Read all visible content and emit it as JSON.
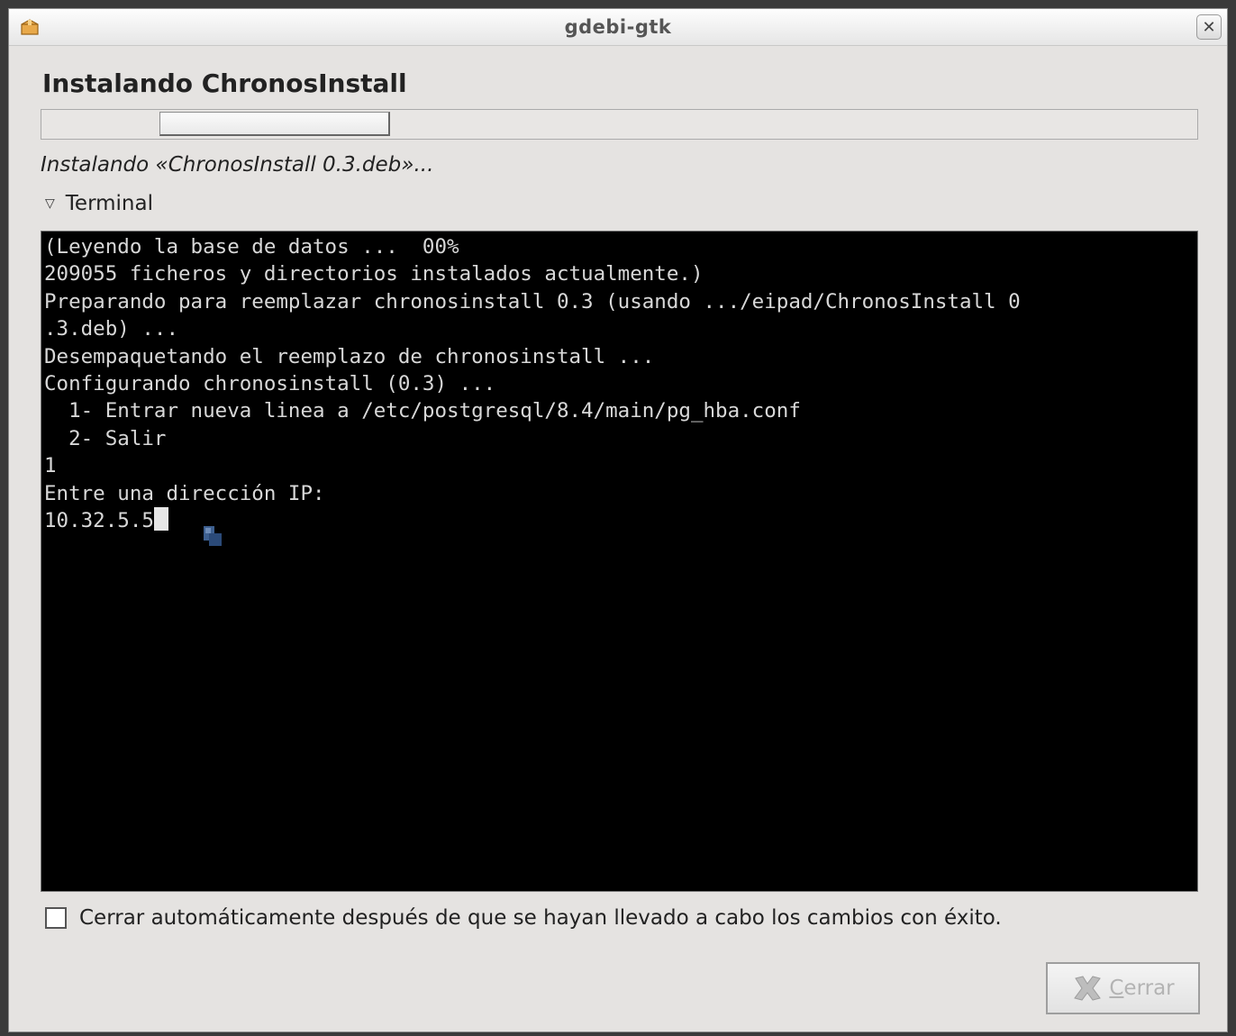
{
  "window": {
    "title": "gdebi-gtk",
    "close_glyph": "✕",
    "app_icon": "package-icon"
  },
  "main": {
    "heading": "Instalando ChronosInstall",
    "progress": {
      "mode": "indeterminate"
    },
    "status": "Instalando «ChronosInstall 0.3.deb»...",
    "expander": {
      "glyph": "▽",
      "label": "Terminal",
      "expanded": true
    }
  },
  "terminal": {
    "background": "#000000",
    "foreground": "#d8d8d8",
    "lines": [
      "(Leyendo la base de datos ...  00%",
      "209055 ficheros y directorios instalados actualmente.)",
      "Preparando para reemplazar chronosinstall 0.3 (usando .../eipad/ChronosInstall 0",
      ".3.deb) ...",
      "Desempaquetando el reemplazo de chronosinstall ...",
      "Configurando chronosinstall (0.3) ...",
      "  1- Entrar nueva linea a /etc/postgresql/8.4/main/pg_hba.conf",
      "  2- Salir",
      "1",
      "Entre una dirección IP:"
    ],
    "input_line": "10.32.5.5"
  },
  "footer": {
    "auto_close_checked": false,
    "auto_close_label": "Cerrar automáticamente después de que se hayan llevado a cabo los cambios con éxito.",
    "close_button_label": "Cerrar",
    "close_button_enabled": false,
    "close_button_icon": "close-x-icon"
  }
}
